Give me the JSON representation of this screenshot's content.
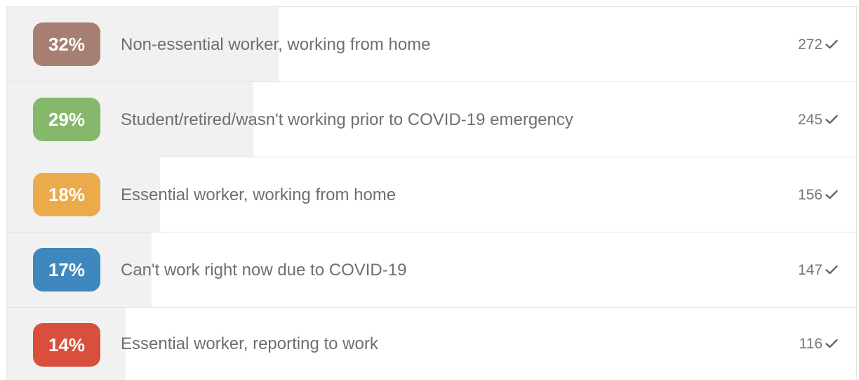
{
  "poll": {
    "options": [
      {
        "percent_label": "32%",
        "percent": 32,
        "label": "Non-essential worker, working from home",
        "count": "272",
        "color": "#a67e72",
        "check_icon": "checkmark-icon"
      },
      {
        "percent_label": "29%",
        "percent": 29,
        "label": "Student/retired/wasn't working prior to COVID-19 emergency",
        "count": "245",
        "color": "#86b86b",
        "check_icon": "checkmark-icon"
      },
      {
        "percent_label": "18%",
        "percent": 18,
        "label": "Essential worker, working from home",
        "count": "156",
        "color": "#ebab4b",
        "check_icon": "checkmark-icon"
      },
      {
        "percent_label": "17%",
        "percent": 17,
        "label": "Can't work right now due to COVID-19",
        "count": "147",
        "color": "#3e88bd",
        "check_icon": "checkmark-icon"
      },
      {
        "percent_label": "14%",
        "percent": 14,
        "label": "Essential worker, reporting to work",
        "count": "116",
        "color": "#d84f3c",
        "check_icon": "checkmark-icon"
      }
    ]
  }
}
